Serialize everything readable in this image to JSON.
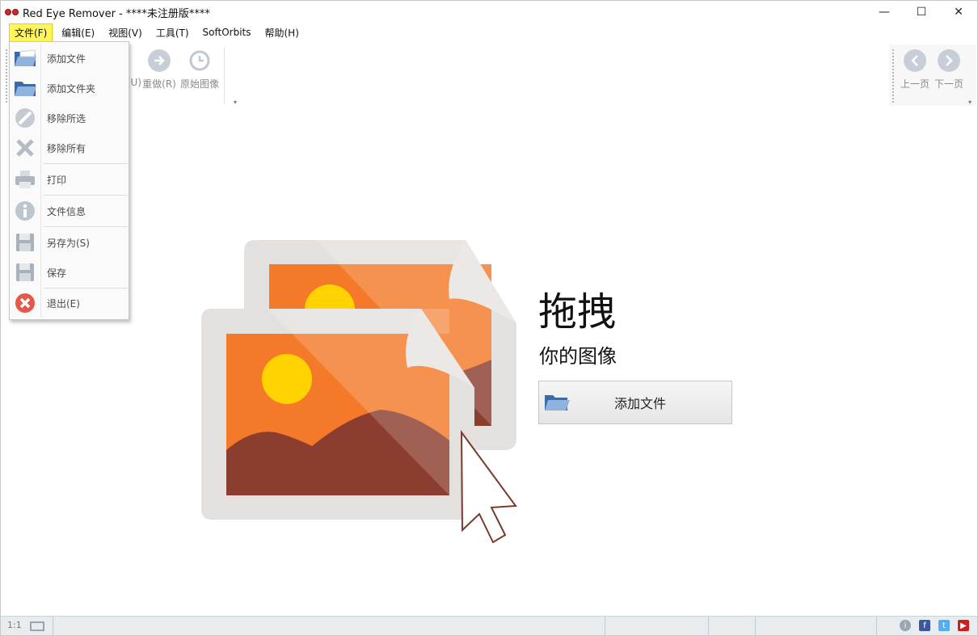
{
  "window": {
    "title": "Red Eye Remover - ****未注册版****",
    "minimize_glyph": "—",
    "maximize_glyph": "☐",
    "close_glyph": "✕"
  },
  "menu": {
    "items": [
      "文件(F)",
      "编辑(E)",
      "视图(V)",
      "工具(T)",
      "SoftOrbits",
      "帮助(H)"
    ]
  },
  "toolbar": {
    "undo_partial_label": "(U)",
    "redo_label": "重做(R)",
    "original_label": "原始图像",
    "prev_label": "上一页",
    "next_label": "下一页"
  },
  "file_menu": {
    "items": [
      {
        "label": "添加文件",
        "icon": "add-file-icon"
      },
      {
        "label": "添加文件夹",
        "icon": "add-folder-icon"
      },
      {
        "label": "移除所选",
        "icon": "remove-selected-icon"
      },
      {
        "label": "移除所有",
        "icon": "remove-all-icon"
      },
      {
        "label": "打印",
        "icon": "print-icon"
      },
      {
        "label": "文件信息",
        "icon": "info-icon"
      },
      {
        "label": "另存为(S)",
        "icon": "save-as-icon"
      },
      {
        "label": "保存",
        "icon": "save-icon"
      },
      {
        "label": "退出(E)",
        "icon": "exit-icon"
      }
    ]
  },
  "hero": {
    "title": "拖拽",
    "subtitle": "你的图像",
    "add_button": "添加文件"
  },
  "statusbar": {
    "zoom": "1:1"
  },
  "colors": {
    "accent_orange": "#f47a2a",
    "mountain_brown": "#8b3e2f",
    "sun_yellow": "#ffd200",
    "frame_grey": "#e3e0dd",
    "menu_highlight": "#fff55c"
  }
}
